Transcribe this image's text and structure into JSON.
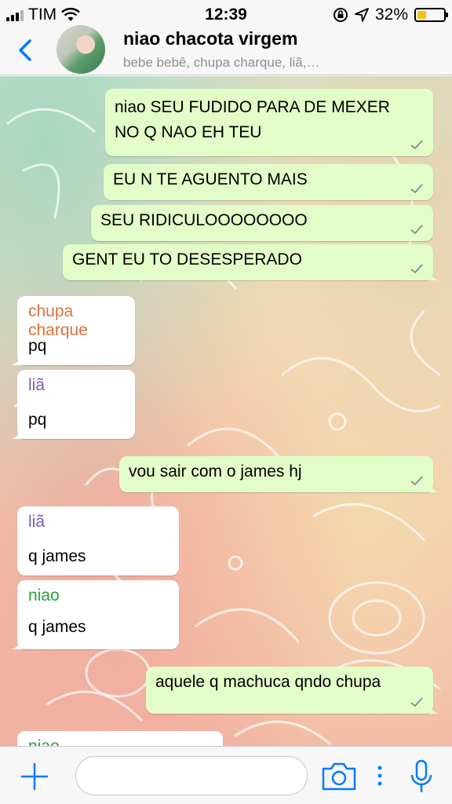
{
  "status_bar": {
    "carrier": "TIM",
    "time": "12:39",
    "battery": "32%"
  },
  "header": {
    "title": "niao chacota virgem",
    "subtitle": "bebe bebê, chupa charque, liã,…"
  },
  "messages": [
    {
      "direction": "out",
      "lines": [
        "niao SEU FUDIDO PARA DE MEXER",
        "NO Q NAO EH TEU"
      ]
    },
    {
      "direction": "out",
      "lines": [
        "EU N TE AGUENTO MAIS"
      ]
    },
    {
      "direction": "out",
      "lines": [
        "SEU RIDICULOOOOOOOO"
      ]
    },
    {
      "direction": "out",
      "lines": [
        "GENT EU TO DESESPERADO"
      ]
    },
    {
      "direction": "in",
      "sender": "chupa charque",
      "sender_color": "#e0703b",
      "text": "pq"
    },
    {
      "direction": "in",
      "sender": "liã",
      "sender_color": "#7a5bb5",
      "text": "pq"
    },
    {
      "direction": "out",
      "lines": [
        "vou sair com o james hj"
      ]
    },
    {
      "direction": "in",
      "sender": "liã",
      "sender_color": "#7a5bb5",
      "text": "q james"
    },
    {
      "direction": "in",
      "sender": "niao",
      "sender_color": "#2e9e3e",
      "text": "q james"
    },
    {
      "direction": "out",
      "lines": [
        "aquele q machuca qndo chupa"
      ]
    },
    {
      "direction": "in",
      "sender": "niao",
      "sender_color": "#2e9e3e",
      "text": ""
    }
  ],
  "composer": {
    "placeholder": ""
  },
  "colors": {
    "accent": "#007aff",
    "outgoing": "#e2fdc8",
    "incoming": "#ffffff",
    "tick": "#8e8e93"
  },
  "icons": [
    "back-chevron-icon",
    "plus-icon",
    "camera-icon",
    "more-dots-icon",
    "microphone-icon",
    "wifi-icon",
    "location-icon",
    "lock-rotation-icon"
  ]
}
